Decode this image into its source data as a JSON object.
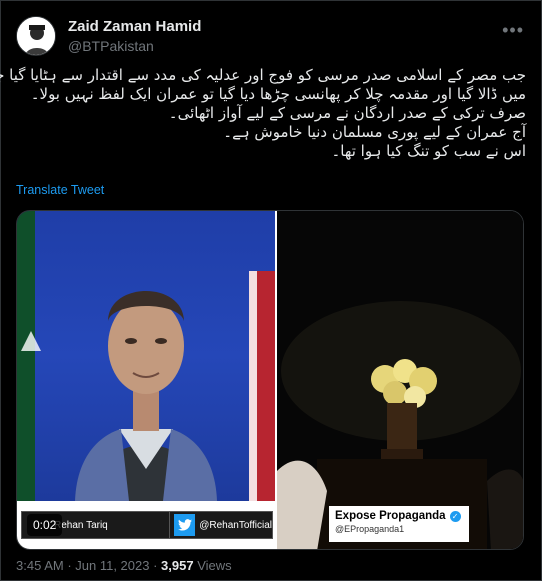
{
  "author": {
    "display_name": "Zaid Zaman Hamid",
    "handle": "@BTPakistan"
  },
  "tweet": {
    "lines": [
      "جب مصر کے اسلامی صدر مرسی کو فوج اور عدلیہ کی مدد سے اقتدار سے ہٹایا گیا جیل",
      "میں ڈالا گیا اور مقدمہ چلا کر پھانسی چڑھا دیا گیا تو عمران ایک لفظ نہیں بولا۔",
      "صرف ترکی کے صدر اردگان نے مرسی کے لیے آواز اٹھائی۔",
      "آج عمران کے لیے پوری مسلمان دنیا خاموش ہے۔",
      "اس نے سب کو تنگ کیا ہوا تھا۔"
    ],
    "translate_label": "Translate Tweet"
  },
  "media": {
    "timer": "0:02",
    "left_name_plate": "Rehan Tariq",
    "left_handle_plate": "@RehanTofficial",
    "watermark_title": "Expose Propaganda",
    "watermark_handle": "@EPropaganda1"
  },
  "meta": {
    "time": "3:45 AM",
    "sep1": " · ",
    "date": "Jun 11, 2023",
    "sep2": " · ",
    "views_count": "3,957",
    "views_label": " Views"
  },
  "icons": {
    "more": "more-icon",
    "twitter": "twitter-bird-icon",
    "verified": "verified-check-icon"
  },
  "colors": {
    "background": "#000000",
    "text_primary": "#e7e9ea",
    "text_secondary": "#71767b",
    "accent": "#1d9bf0",
    "border": "#2f3336"
  }
}
